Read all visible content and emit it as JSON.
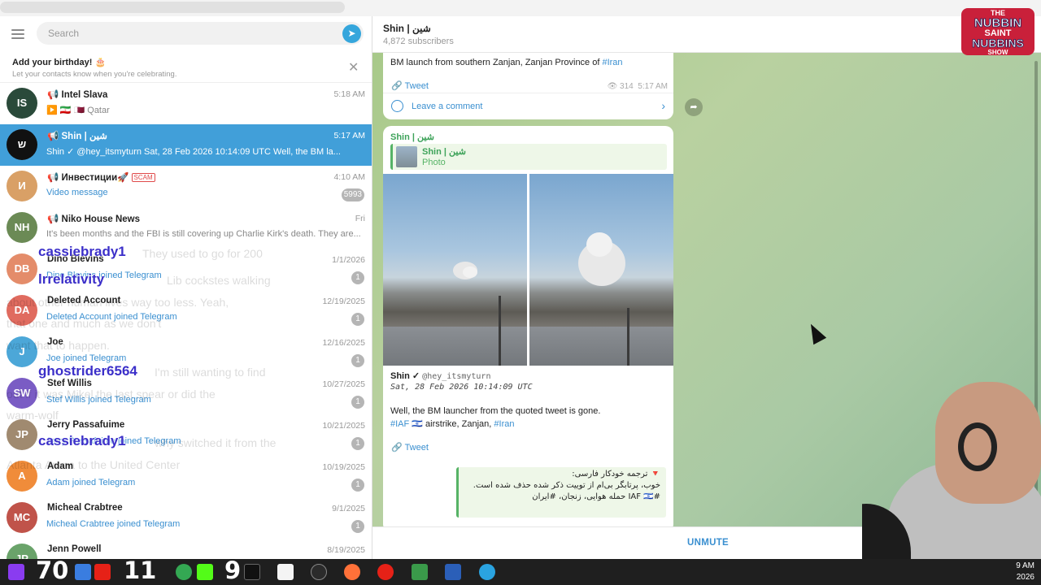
{
  "sidebar": {
    "search_placeholder": "Search",
    "birthday": {
      "title": "Add your birthday! 🎂",
      "subtitle": "Let your contacts know when you're celebrating."
    },
    "chats": [
      {
        "name": "📢 Intel Slava",
        "time": "5:18 AM",
        "preview": "▶️ 🇮🇷 🇶🇦 Qatar",
        "badge": "",
        "initials": "IS",
        "color": "#2a4a3a"
      },
      {
        "name": "📢 Shin | شين",
        "time": "5:17 AM",
        "preview": "Shin ✓ @hey_itsmyturn Sat, 28 Feb 2026 10:14:09 UTC  Well, the BM la...",
        "badge": "",
        "initials": "ש",
        "color": "#111111"
      },
      {
        "name": "📢 Инвестиции🚀",
        "scam": "SCAM",
        "time": "4:10 AM",
        "preview": "Video message",
        "badge": "5993",
        "initials": "И",
        "color": "#d9a066"
      },
      {
        "name": "📢 Niko House News",
        "time": "Fri",
        "preview": "It's been months and the FBI is still covering up Charlie Kirk's death. They are...",
        "badge": "",
        "initials": "NH",
        "color": "#6b8a55"
      },
      {
        "name": "Dino Blevins",
        "time": "1/1/2026",
        "preview": "Dino Blevins joined Telegram",
        "badge": "1",
        "initials": "DB",
        "color": "#e48c6a"
      },
      {
        "name": "Deleted Account",
        "time": "12/19/2025",
        "preview": "Deleted Account joined Telegram",
        "badge": "1",
        "initials": "DA",
        "color": "#e06b5f"
      },
      {
        "name": "Joe",
        "time": "12/16/2025",
        "preview": "Joe joined Telegram",
        "badge": "1",
        "initials": "J",
        "color": "#4ca7d8"
      },
      {
        "name": "Stef Willis",
        "time": "10/27/2025",
        "preview": "Stef Willis joined Telegram",
        "badge": "1",
        "initials": "SW",
        "color": "#7a5cc4"
      },
      {
        "name": "Jerry Passafuime",
        "time": "10/21/2025",
        "preview": "Jerry Passafuime joined Telegram",
        "badge": "1",
        "initials": "JP",
        "color": "#a08a70"
      },
      {
        "name": "Adam",
        "time": "10/19/2025",
        "preview": "Adam joined Telegram",
        "badge": "1",
        "initials": "A",
        "color": "#f08c3a"
      },
      {
        "name": "Micheal Crabtree",
        "time": "9/1/2025",
        "preview": "Micheal Crabtree joined Telegram",
        "badge": "1",
        "initials": "MC",
        "color": "#c0534a"
      },
      {
        "name": "Jenn Powell",
        "time": "8/19/2025",
        "preview": "",
        "badge": "",
        "initials": "JP",
        "color": "#6aa36a"
      }
    ]
  },
  "stream_overlay": {
    "users": [
      "cassiebrady1",
      "lrrelativity",
      "ghostrider6564",
      "cassiebrady1"
    ],
    "faint": [
      "They used to go for 200",
      "Lib cockstes walking",
      "about other human lives way too less. Yeah,",
      "that one and much as we don't",
      "want that to happen.",
      "I'm still wanting to find",
      "out if it was Mikel the last spear or did the",
      "warm-wolf",
      "why switched it from the",
      "Atlanta Arena to the United Center"
    ],
    "logo_lines": [
      "THE",
      "NUBBIN",
      "SAINT",
      "NUBBINS",
      "SHOW"
    ]
  },
  "channel": {
    "title": "Shin | شين",
    "subscribers": "4,872 subscribers",
    "msg1": {
      "text_prefix": "BM launch from southern Zanjan, Zanjan Province of ",
      "hashtag": "#Iran",
      "tweet": "Tweet",
      "views": "314",
      "time": "5:17 AM",
      "comment": "Leave a comment"
    },
    "msg2": {
      "sender": "Shin | شين",
      "quote_name": "Shin | شين",
      "quote_type": "Photo",
      "author": "Shin ✓",
      "handle": "@hey_itsmyturn",
      "date": "Sat, 28 Feb 2026 10:14:09 UTC",
      "body1": "Well, the BM launcher from the quoted tweet is gone.",
      "body2_tag1": "#IAF 🇮🇱",
      "body2_mid": " airstrike, Zanjan, ",
      "body2_tag2": "#Iran",
      "tweet": "Tweet",
      "fa_lines": [
        "🔻 ترجمه خودکار فارسی:",
        "خوب، پرتابگر بی‌ام از توییت ذکر شده حذف شده است.",
        "#IAF 🇮🇱 حمله هوایی، زنجان، #ایران"
      ]
    }
  },
  "bottom": {
    "unmute": "UNMUTE"
  },
  "taskbar": {
    "numbers": [
      "70",
      "11",
      "9"
    ],
    "clock_time": "9 AM",
    "clock_date": "2026"
  },
  "colors": {
    "accent": "#419fd9",
    "link": "#3a8fd0",
    "green": "#3ea35a"
  }
}
